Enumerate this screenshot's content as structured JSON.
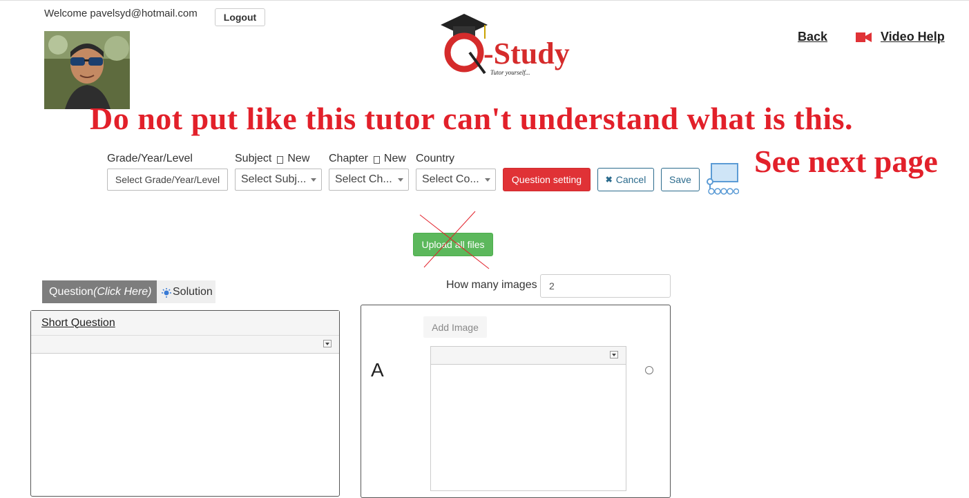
{
  "header": {
    "welcome_text": "Welcome pavelsyd@hotmail.com",
    "logout_label": "Logout",
    "logo_text": "-Study",
    "logo_tagline": "Tutor yourself...",
    "back_label": "Back",
    "video_help_label": "Video Help"
  },
  "annotations": {
    "main": "Do not put like this tutor can't understand what is this.",
    "secondary": "See next page"
  },
  "filters": {
    "grade": {
      "label": "Grade/Year/Level",
      "value": "Select Grade/Year/Level"
    },
    "subject": {
      "label": "Subject",
      "new_label": "New",
      "value": "Select Subj..."
    },
    "chapter": {
      "label": "Chapter",
      "new_label": "New",
      "value": "Select Ch..."
    },
    "country": {
      "label": "Country",
      "value": "Select Co..."
    }
  },
  "actions": {
    "question_setting": "Question setting",
    "cancel": "Cancel",
    "save": "Save",
    "upload_all": "Upload all files"
  },
  "tabs": {
    "question_prefix": "Question",
    "question_hint": "(Click Here)",
    "solution": "Solution"
  },
  "images_count": {
    "label": "How many images",
    "value": "2"
  },
  "question_panel": {
    "title": "Short Question"
  },
  "answer_panel": {
    "add_image_label": "Add Image",
    "option_letter": "A"
  },
  "colors": {
    "accent_red": "#e03236",
    "upload_green": "#5cb85c",
    "annotation_red": "#e2202a",
    "tab_grey": "#7d7d7d"
  }
}
